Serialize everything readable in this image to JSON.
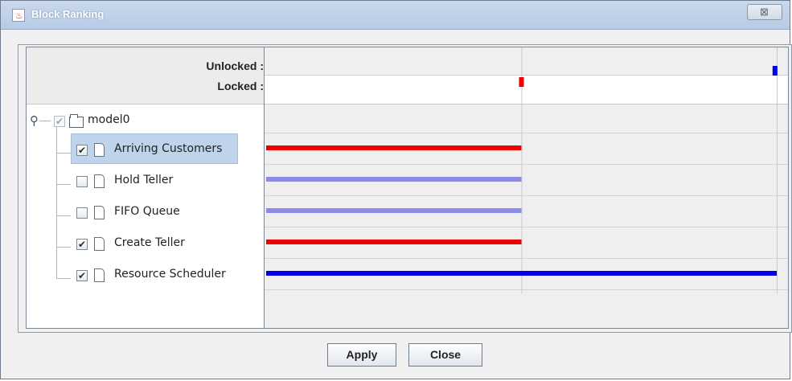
{
  "window": {
    "title": "Block Ranking",
    "close_glyph": "⊠",
    "app_icon": "java-icon"
  },
  "legend": {
    "unlocked_label": "Unlocked :",
    "locked_label": "Locked :",
    "unlocked_color": "#0000ee",
    "locked_color": "#ee0000"
  },
  "tree": {
    "root": {
      "label": "model0",
      "checked": true,
      "enabled": false
    },
    "items": [
      {
        "label": "Arriving Customers",
        "checked": true,
        "selected": true
      },
      {
        "label": "Hold Teller",
        "checked": false,
        "selected": false
      },
      {
        "label": "FIFO Queue",
        "checked": false,
        "selected": false
      },
      {
        "label": "Create Teller",
        "checked": true,
        "selected": false
      },
      {
        "label": "Resource Scheduler",
        "checked": true,
        "selected": false
      }
    ]
  },
  "chart_data": {
    "type": "bar",
    "orientation": "horizontal",
    "categories": [
      "Arriving Customers",
      "Hold Teller",
      "FIFO Queue",
      "Create Teller",
      "Resource Scheduler"
    ],
    "values": [
      0.5,
      0.5,
      0.5,
      0.5,
      1.0
    ],
    "bar_colors": [
      "#ee0000",
      "#8c8ce8",
      "#8c8ce8",
      "#ee0000",
      "#0000ee"
    ],
    "xlim": [
      0,
      1
    ],
    "grid": true,
    "markers": {
      "locked_position": 0.5,
      "unlocked_position": 0.995
    }
  },
  "buttons": {
    "apply": "Apply",
    "close": "Close"
  }
}
